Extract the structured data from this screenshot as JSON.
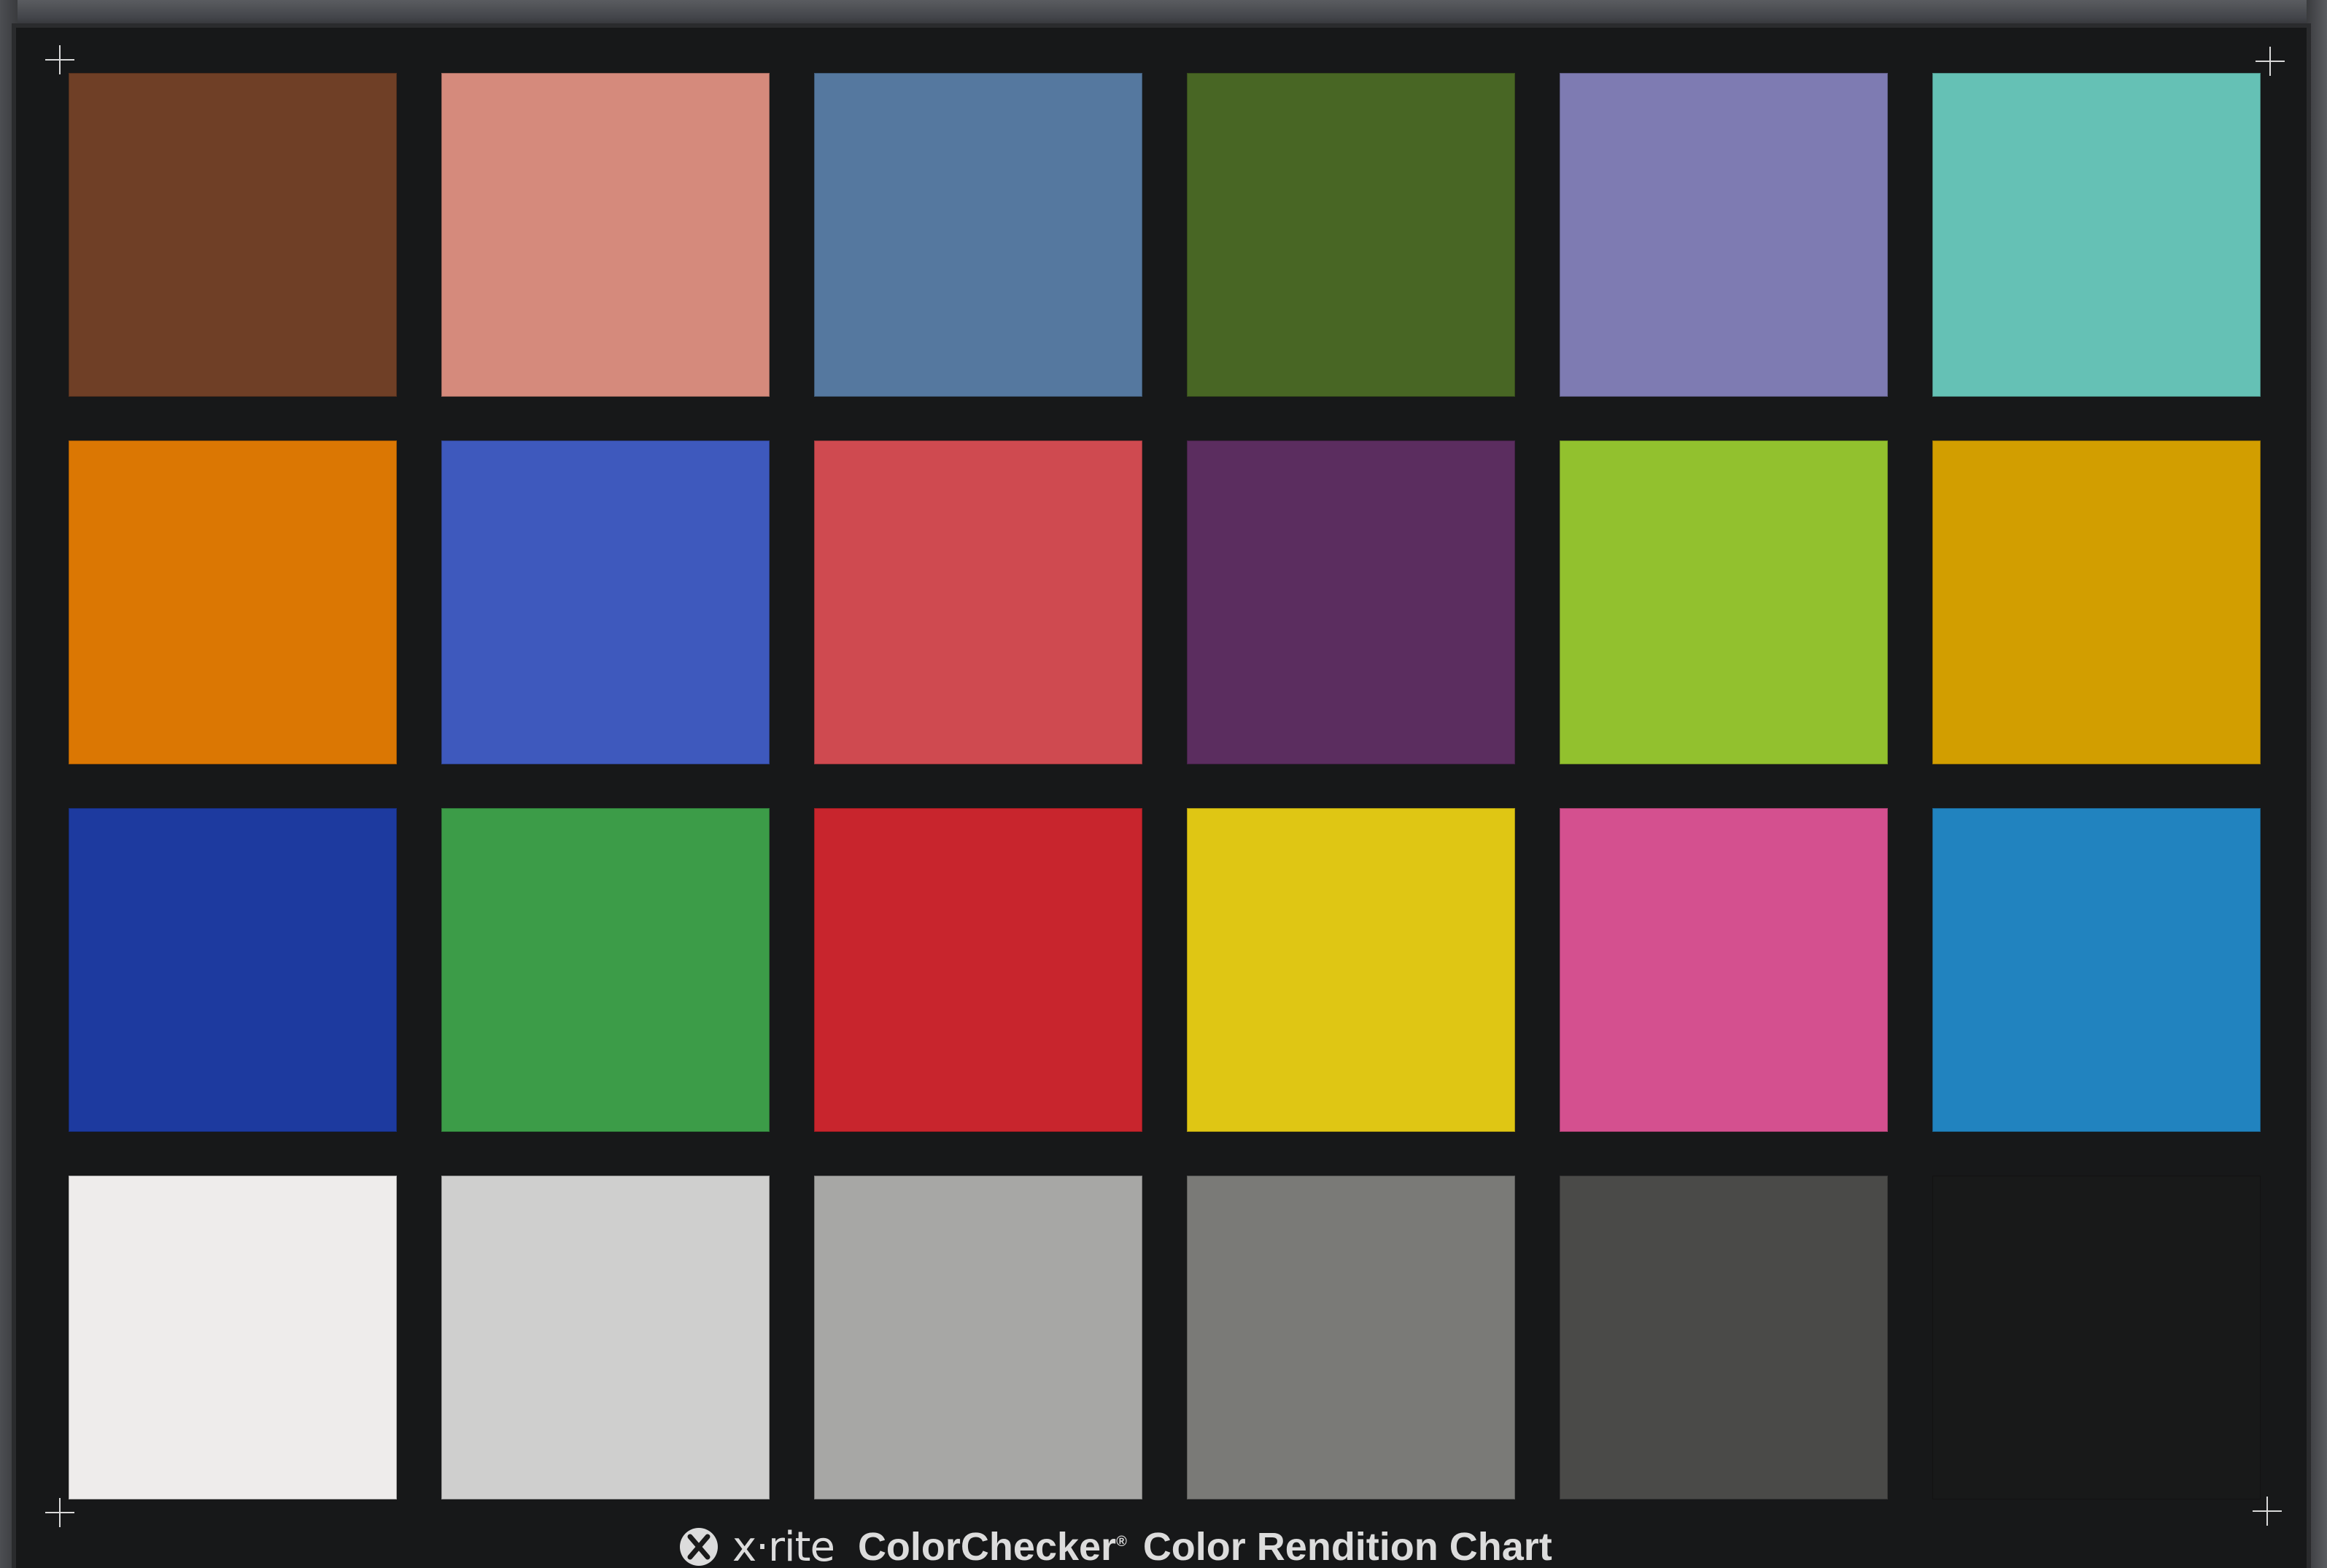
{
  "patches": [
    {
      "color": "#6f3f26"
    },
    {
      "color": "#d58a7c"
    },
    {
      "color": "#55789f"
    },
    {
      "color": "#486624"
    },
    {
      "color": "#7e7bb2"
    },
    {
      "color": "#65c1b5"
    },
    {
      "color": "#db7703"
    },
    {
      "color": "#3e59bd"
    },
    {
      "color": "#cf4a50"
    },
    {
      "color": "#5b2d5f"
    },
    {
      "color": "#92c12e"
    },
    {
      "color": "#d29e00"
    },
    {
      "color": "#1d3a9f"
    },
    {
      "color": "#3c9c48"
    },
    {
      "color": "#c8252d"
    },
    {
      "color": "#dfc614"
    },
    {
      "color": "#d4508f"
    },
    {
      "color": "#2183bf"
    },
    {
      "color": "#eeeceb"
    },
    {
      "color": "#cfcfce"
    },
    {
      "color": "#a7a7a5"
    },
    {
      "color": "#7a7a77"
    },
    {
      "color": "#4a4a48"
    },
    {
      "color": "#181919"
    }
  ],
  "footer": {
    "brand": "x·rite",
    "product": "ColorChecker",
    "registered": "®",
    "title": "Color Rendition Chart"
  }
}
